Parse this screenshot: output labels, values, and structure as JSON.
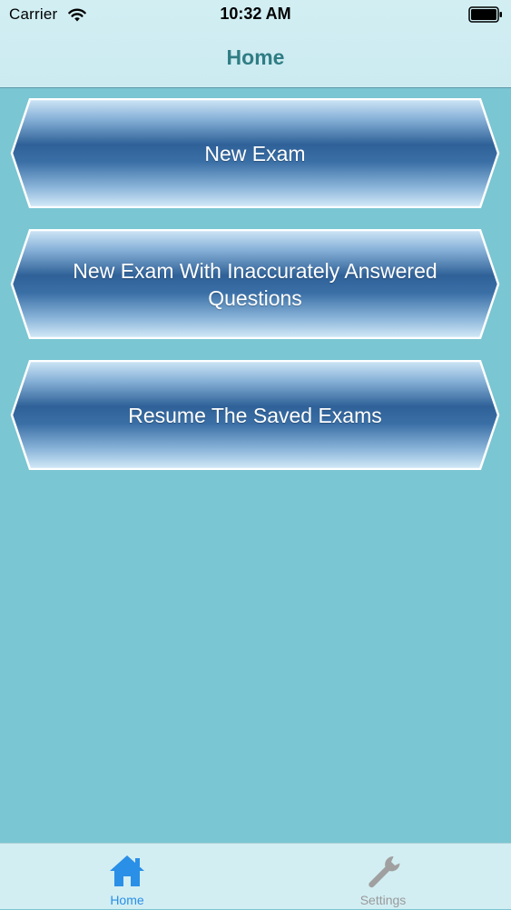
{
  "status_bar": {
    "carrier": "Carrier",
    "time": "10:32 AM",
    "icons": [
      "wifi-icon",
      "battery-icon"
    ]
  },
  "nav": {
    "title": "Home"
  },
  "menu": {
    "items": [
      {
        "label": "New Exam"
      },
      {
        "label": "New Exam With Inaccurately Answered Questions"
      },
      {
        "label": "Resume The Saved Exams"
      }
    ]
  },
  "tab_bar": {
    "items": [
      {
        "label": "Home",
        "icon": "home-icon",
        "selected": true
      },
      {
        "label": "Settings",
        "icon": "wrench-icon",
        "selected": false
      }
    ]
  },
  "colors": {
    "background": "#7ac6d2",
    "header_background": "#d2eef3",
    "title_color": "#2f7d84",
    "button_dark": "#2d5f95",
    "button_light": "#c9e3f5",
    "tab_selected": "#2a8fe6",
    "tab_unselected": "#9a9a9a"
  }
}
